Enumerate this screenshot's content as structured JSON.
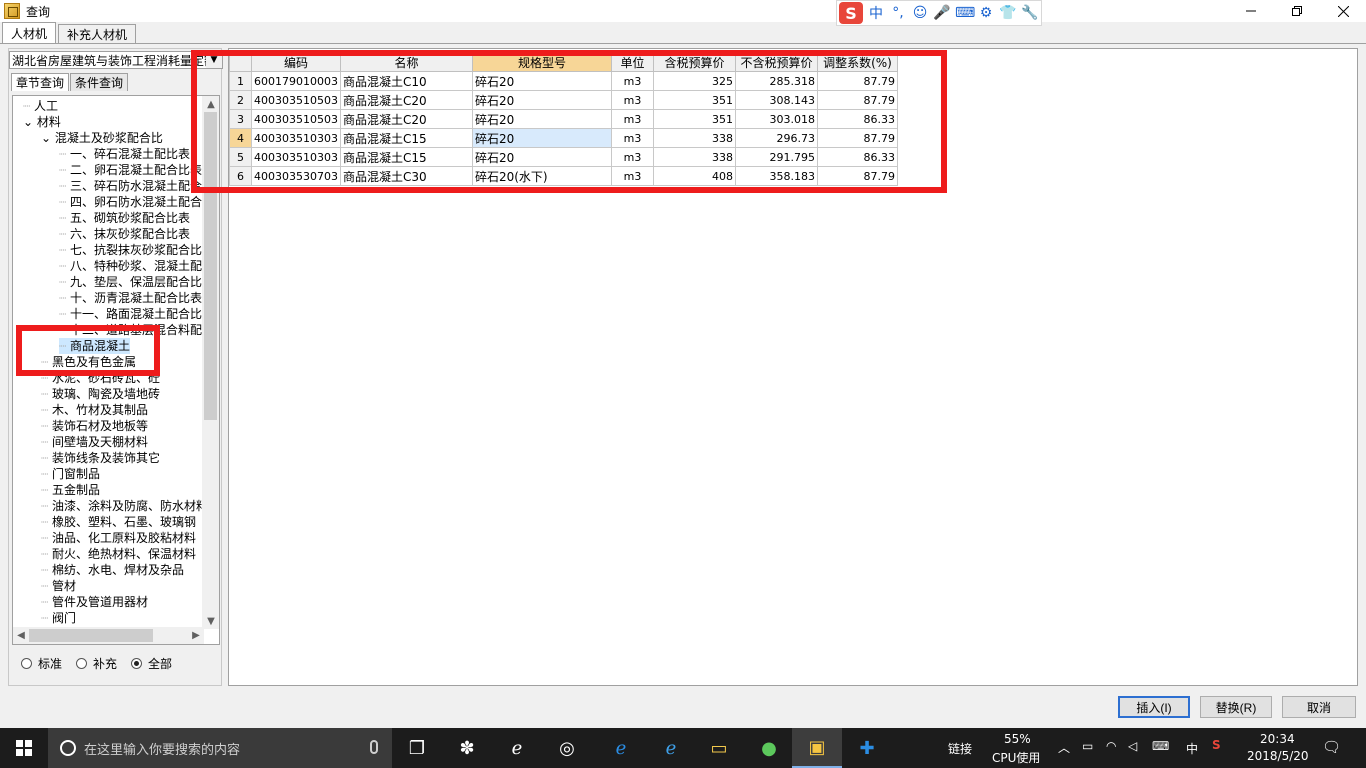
{
  "window": {
    "title": "查询"
  },
  "ime": {
    "logo": "S",
    "glyphs": [
      "中",
      "°,",
      "☺",
      "🎤",
      "⌨",
      "⚙",
      "👕",
      "🔧"
    ]
  },
  "tabs": [
    "人材机",
    "补充人材机"
  ],
  "left": {
    "quota": "湖北省房屋建筑与装饰工程消耗量定额",
    "subtabs": [
      "章节查询",
      "条件查询"
    ],
    "tree": [
      {
        "label": "人工",
        "level": 0
      },
      {
        "label": "材料",
        "level": 0,
        "expanded": true
      },
      {
        "label": "混凝土及砂浆配合比",
        "level": 1,
        "expanded": true
      },
      {
        "label": "一、碎石混凝土配比表",
        "level": 2
      },
      {
        "label": "二、卵石混凝土配合比表",
        "level": 2
      },
      {
        "label": "三、碎石防水混凝土配合比表",
        "level": 2
      },
      {
        "label": "四、卵石防水混凝土配合比表",
        "level": 2
      },
      {
        "label": "五、砌筑砂浆配合比表",
        "level": 2
      },
      {
        "label": "六、抹灰砂浆配合比表",
        "level": 2
      },
      {
        "label": "七、抗裂抹灰砂浆配合比表",
        "level": 2
      },
      {
        "label": "八、特种砂浆、混凝土配合比表",
        "level": 2
      },
      {
        "label": "九、垫层、保温层配合比表",
        "level": 2
      },
      {
        "label": "十、沥青混凝土配合比表",
        "level": 2
      },
      {
        "label": "十一、路面混凝土配合比表",
        "level": 2
      },
      {
        "label": "十二、道路基层混合料配合比表",
        "level": 2
      },
      {
        "label": "商品混凝土",
        "level": 2,
        "selected": true
      },
      {
        "label": "黑色及有色金属",
        "level": 1
      },
      {
        "label": "水泥、砂石砖瓦、砼",
        "level": 1
      },
      {
        "label": "玻璃、陶瓷及墙地砖",
        "level": 1
      },
      {
        "label": "木、竹材及其制品",
        "level": 1
      },
      {
        "label": "装饰石材及地板等",
        "level": 1
      },
      {
        "label": "间壁墙及天棚材料",
        "level": 1
      },
      {
        "label": "装饰线条及装饰其它",
        "level": 1
      },
      {
        "label": "门窗制品",
        "level": 1
      },
      {
        "label": "五金制品",
        "level": 1
      },
      {
        "label": "油漆、涂料及防腐、防水材料",
        "level": 1
      },
      {
        "label": "橡胶、塑料、石墨、玻璃钢",
        "level": 1
      },
      {
        "label": "油品、化工原料及胶粘材料",
        "level": 1
      },
      {
        "label": "耐火、绝热材料、保温材料",
        "level": 1
      },
      {
        "label": "棉纺、水电、焊材及杂品",
        "level": 1
      },
      {
        "label": "管材",
        "level": 1
      },
      {
        "label": "管件及管道用器材",
        "level": 1
      },
      {
        "label": "阀门",
        "level": 1
      }
    ],
    "radios": [
      {
        "label": "标准",
        "checked": false
      },
      {
        "label": "补充",
        "checked": false
      },
      {
        "label": "全部",
        "checked": true
      }
    ]
  },
  "grid": {
    "headers": [
      "",
      "编码",
      "名称",
      "规格型号",
      "单位",
      "含税预算价",
      "不含税预算价",
      "调整系数(%)"
    ],
    "rows": [
      {
        "n": "1",
        "code": "600179010003",
        "name": "商品混凝土C10",
        "spec": "碎石20",
        "unit": "m3",
        "tax": "325",
        "notax": "285.318",
        "factor": "87.79"
      },
      {
        "n": "2",
        "code": "400303510503",
        "name": "商品混凝土C20",
        "spec": "碎石20",
        "unit": "m3",
        "tax": "351",
        "notax": "308.143",
        "factor": "87.79"
      },
      {
        "n": "3",
        "code": "400303510503",
        "name": "商品混凝土C20",
        "spec": "碎石20",
        "unit": "m3",
        "tax": "351",
        "notax": "303.018",
        "factor": "86.33"
      },
      {
        "n": "4",
        "code": "400303510303",
        "name": "商品混凝土C15",
        "spec": "碎石20",
        "unit": "m3",
        "tax": "338",
        "notax": "296.73",
        "factor": "87.79"
      },
      {
        "n": "5",
        "code": "400303510303",
        "name": "商品混凝土C15",
        "spec": "碎石20",
        "unit": "m3",
        "tax": "338",
        "notax": "291.795",
        "factor": "86.33"
      },
      {
        "n": "6",
        "code": "400303530703",
        "name": "商品混凝土C30",
        "spec": "碎石20(水下)",
        "unit": "m3",
        "tax": "408",
        "notax": "358.183",
        "factor": "87.79"
      }
    ]
  },
  "buttons": {
    "insert": "插入(I)",
    "replace": "替换(R)",
    "cancel": "取消"
  },
  "taskbar": {
    "search_placeholder": "在这里输入你要搜索的内容",
    "link": "链接",
    "cpu_value": "55%",
    "cpu_label": "CPU使用",
    "lang": "中",
    "time": "20:34",
    "date": "2018/5/20"
  }
}
